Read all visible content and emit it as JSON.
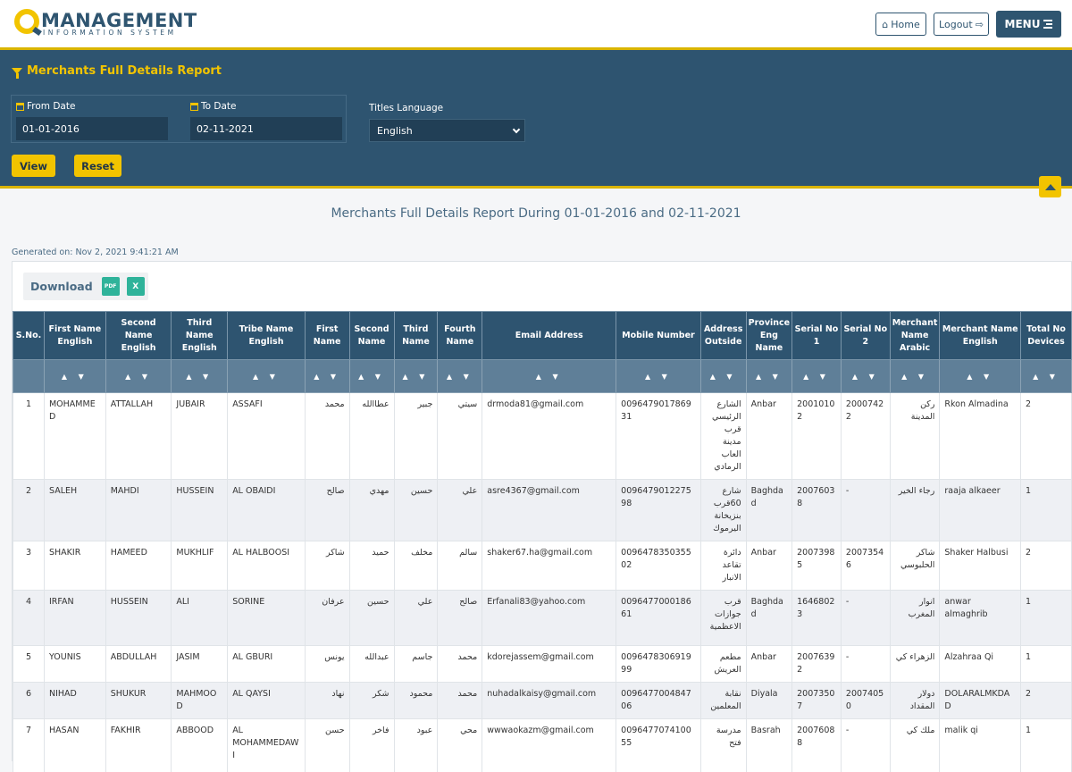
{
  "header": {
    "logo_title": "MANAGEMENT",
    "logo_subtitle": "INFORMATION SYSTEM",
    "home_label": "Home",
    "logout_label": "Logout",
    "menu_label": "MENU"
  },
  "filter": {
    "title": "Merchants Full Details Report",
    "from_label": "From Date",
    "from_value": "01-01-2016",
    "to_label": "To Date",
    "to_value": "02-11-2021",
    "language_label": "Titles Language",
    "language_value": "English",
    "view_label": "View",
    "reset_label": "Reset"
  },
  "report": {
    "title": "Merchants Full Details Report During 01-01-2016 and 02-11-2021",
    "generated": "Generated on: Nov 2, 2021 9:41:21 AM",
    "download_label": "Download",
    "pdf_label": "PDF",
    "excel_label": "X",
    "sort_arrows": "▲ ▼"
  },
  "columns": [
    "S.No.",
    "First Name English",
    "Second Name English",
    "Third Name English",
    "Tribe Name English",
    "First Name",
    "Second Name",
    "Third Name",
    "Fourth Name",
    "Email Address",
    "Mobile Number",
    "Address Outside",
    "Province Eng Name",
    "Serial No 1",
    "Serial No 2",
    "Merchant Name Arabic",
    "Merchant Name English",
    "Total No Devices"
  ],
  "rows": [
    [
      "1",
      "MOHAMMED",
      "ATTALLAH",
      "JUBAIR",
      "ASSAFI",
      "محمد",
      "عطاالله",
      "جبير",
      "سيتي",
      "drmoda81@gmail.com",
      "009647901786931",
      "الشارع الرئيسي قرب مدينة العاب الرمادي",
      "Anbar",
      "20010102",
      "20007422",
      "ركن المدينة",
      "Rkon Almadina",
      "2"
    ],
    [
      "2",
      "SALEH",
      "MAHDI",
      "HUSSEIN",
      "AL OBAIDI",
      "صالح",
      "مهدي",
      "حسين",
      "علي",
      "asre4367@gmail.com",
      "009647901227598",
      "شارع 60قرب بنزيخانة اليرموك",
      "Baghdad",
      "20076038",
      "-",
      "رجاء الخير",
      "raaja alkaeer",
      "1"
    ],
    [
      "3",
      "SHAKIR",
      "HAMEED",
      "MUKHLIF",
      "AL HALBOOSI",
      "شاكر",
      "حميد",
      "مخلف",
      "سالم",
      "shaker67.ha@gmail.com",
      "009647835035502",
      "دائرة تقاعد الانبار",
      "Anbar",
      "20073985",
      "20073546",
      "شاكر الحلبوسي",
      "Shaker Halbusi",
      "2"
    ],
    [
      "4",
      "IRFAN",
      "HUSSEIN",
      "ALI",
      "SORINE",
      "عرفان",
      "حسين",
      "علي",
      "صالح",
      "Erfanali83@yahoo.com",
      "009647700018661",
      "قرب جوازات الاعظمية",
      "Baghdad",
      "16468023",
      "-",
      "انوار المغرب",
      "anwar almaghrib",
      "1"
    ],
    [
      "5",
      "YOUNIS",
      "ABDULLAH",
      "JASIM",
      "AL GBURI",
      "يونس",
      "عبدالله",
      "جاسم",
      "محمد",
      "kdorejassem@gmail.com",
      "009647830691999",
      "مطعم العريش",
      "Anbar",
      "20076392",
      "-",
      "الزهراء كي",
      "Alzahraa Qi",
      "1"
    ],
    [
      "6",
      "NIHAD",
      "SHUKUR",
      "MAHMOOD",
      "AL QAYSI",
      "نهاد",
      "شكر",
      "محمود",
      "محمد",
      "nuhadalkaisy@gmail.com",
      "009647700484706",
      "نقابة المعلمين",
      "Diyala",
      "20073507",
      "20074050",
      "دولار المقداد",
      "DOLARALMKDAD",
      "2"
    ],
    [
      "7",
      "HASAN",
      "FAKHIR",
      "ABBOOD",
      "AL MOHAMMEDAWI",
      "حسن",
      "فاخر",
      "عبود",
      "محي",
      "wwwaokazm@gmail.com",
      "009647707410055",
      "مدرسة فتح",
      "Basrah",
      "20076088",
      "-",
      "ملك كي",
      "malik qi",
      "1"
    ]
  ]
}
